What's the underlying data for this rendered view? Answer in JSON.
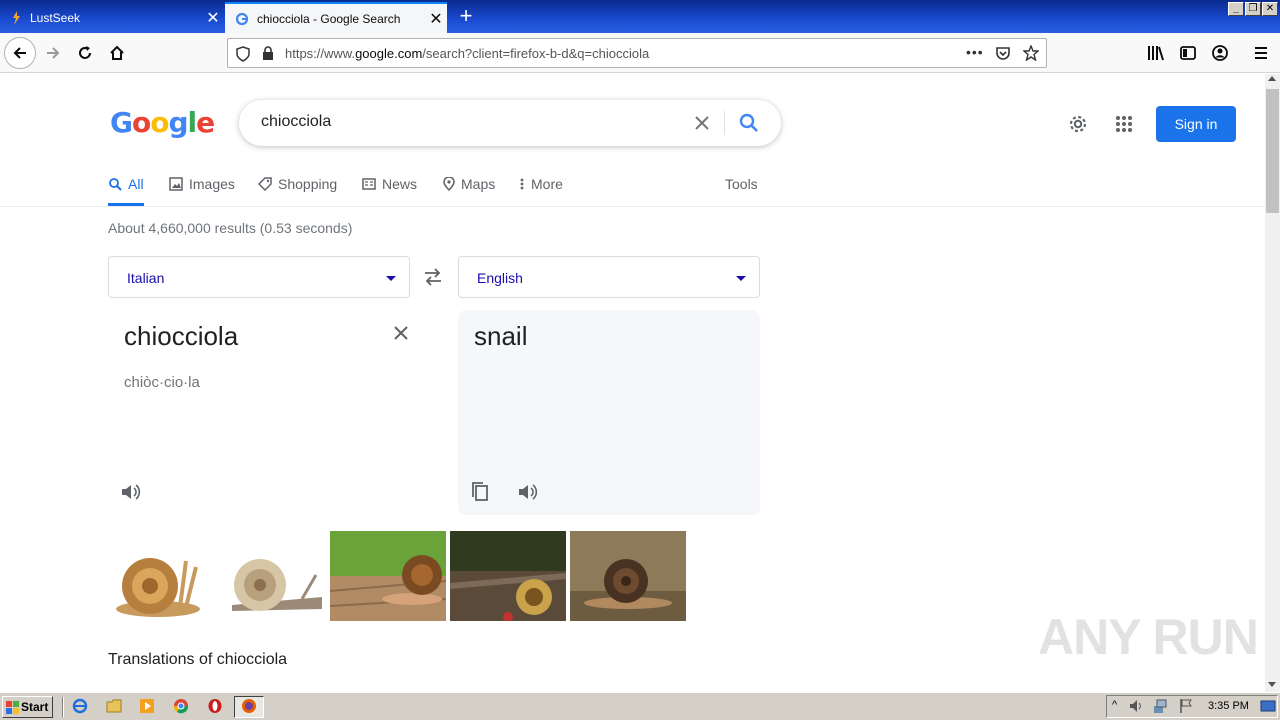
{
  "browser": {
    "tabs": [
      {
        "title": "LustSeek",
        "active": false
      },
      {
        "title": "chiocciola - Google Search",
        "active": true
      }
    ],
    "url": "https://www.google.com/search?client=firefox-b-d&q=chiocciola",
    "url_prefix": "https://www.",
    "url_host": "google.com",
    "url_path": "/search?client=firefox-b-d&q=chiocciola"
  },
  "google": {
    "logo_text": "Google",
    "query": "chiocciola",
    "sign_in_label": "Sign in",
    "tabs": [
      {
        "label": "All",
        "icon": "search-icon",
        "active": true
      },
      {
        "label": "Images",
        "icon": "image-icon"
      },
      {
        "label": "Shopping",
        "icon": "tag-icon"
      },
      {
        "label": "News",
        "icon": "news-icon"
      },
      {
        "label": "Maps",
        "icon": "map-pin-icon"
      },
      {
        "label": "More",
        "icon": "more-vert-icon"
      }
    ],
    "tools_label": "Tools",
    "result_stats": "About 4,660,000 results (0.53 seconds)"
  },
  "translator": {
    "source_lang": "Italian",
    "target_lang": "English",
    "source_word": "chiocciola",
    "source_syllables": "chiòc·cio·la",
    "target_word": "snail"
  },
  "translations_heading": "Translations of chiocciola",
  "watermark": "ANY RUN",
  "taskbar": {
    "start_label": "Start",
    "clock": "3:35 PM"
  }
}
